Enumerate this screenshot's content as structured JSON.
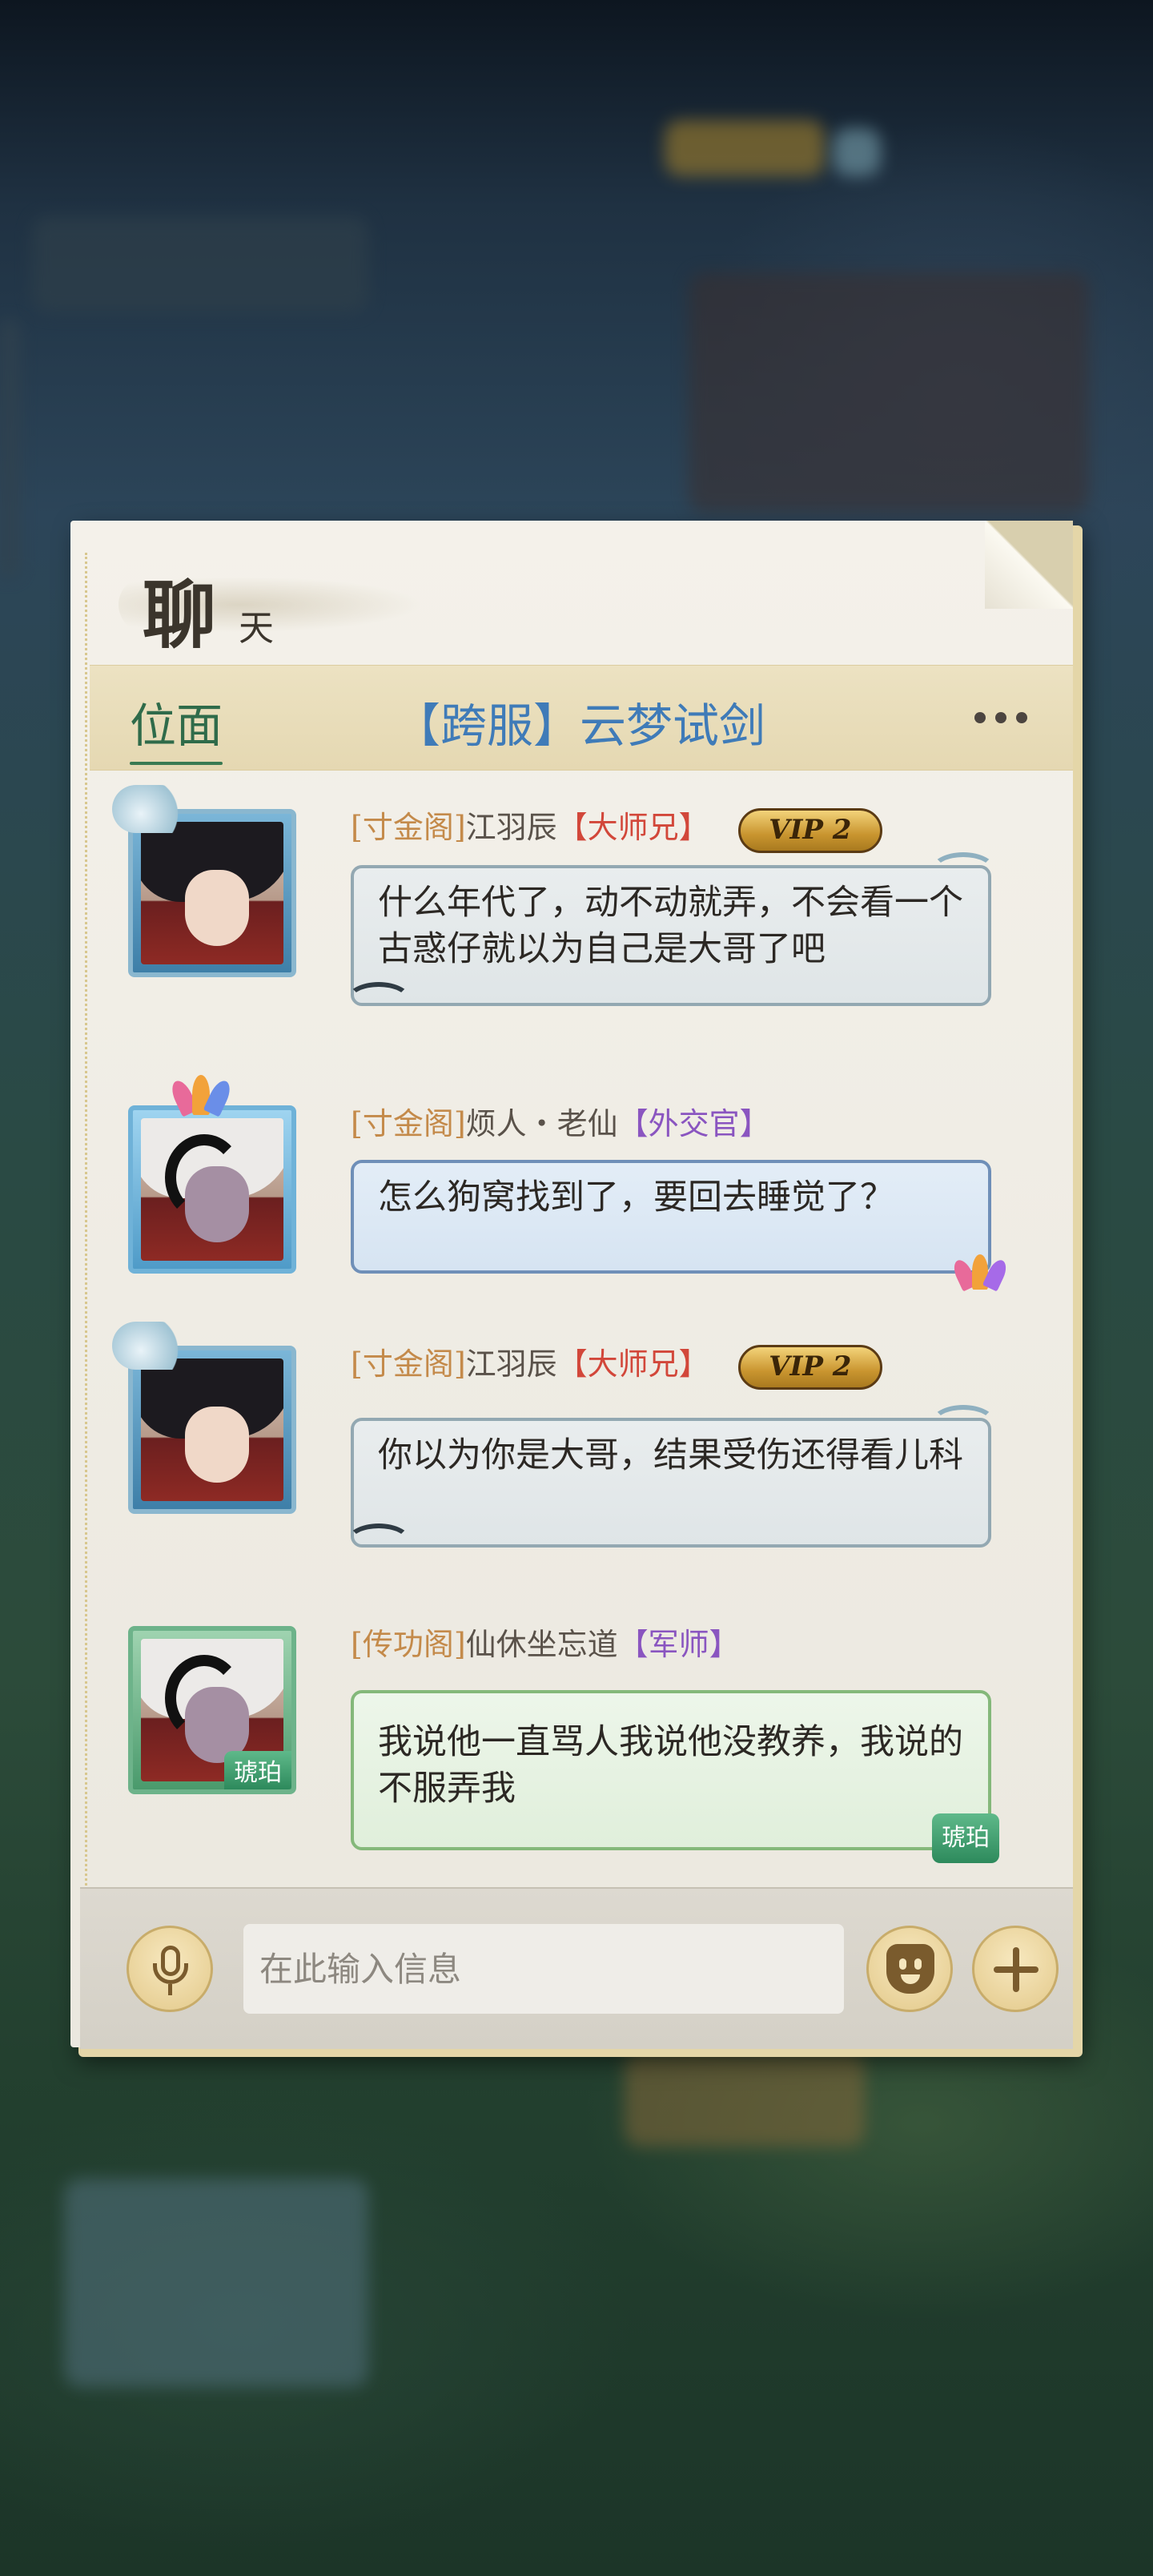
{
  "panel": {
    "title_main": "聊",
    "title_sub": "天",
    "current_tab": "位面",
    "channel_label": "【跨服】云梦试剑"
  },
  "messages": [
    {
      "guild": "[寸金阁]",
      "name": "江羽辰",
      "rank": "【大师兄】",
      "vip": "VIP 2",
      "text": "什么年代了，动不动就弄，不会看一个古惑仔就以为自己是大哥了吧"
    },
    {
      "guild": "[寸金阁]",
      "name": "烦人・老仙",
      "rank": "【外交官】",
      "text": "怎么狗窝找到了，要回去睡觉了？"
    },
    {
      "guild": "[寸金阁]",
      "name": "江羽辰",
      "rank": "【大师兄】",
      "vip": "VIP 2",
      "text": "你以为你是大哥，结果受伤还得看儿科"
    },
    {
      "guild": "[传功阁]",
      "name": "仙休坐忘道",
      "rank": "【军师】",
      "avatar_tag": "琥珀",
      "bubble_tag": "琥珀",
      "text": "我说他一直骂人我说他没教养，我说的不服弄我"
    }
  ],
  "input": {
    "placeholder": "在此输入信息"
  },
  "icons": [
    "mic-icon",
    "emoji-icon",
    "plus-icon",
    "more-icon"
  ],
  "colors": {
    "tab_active": "#2f6b4a",
    "channel": "#3f7bb8",
    "guild": "#c48a4a",
    "rank_red": "#d2473a",
    "rank_purple": "#8a55c0"
  }
}
